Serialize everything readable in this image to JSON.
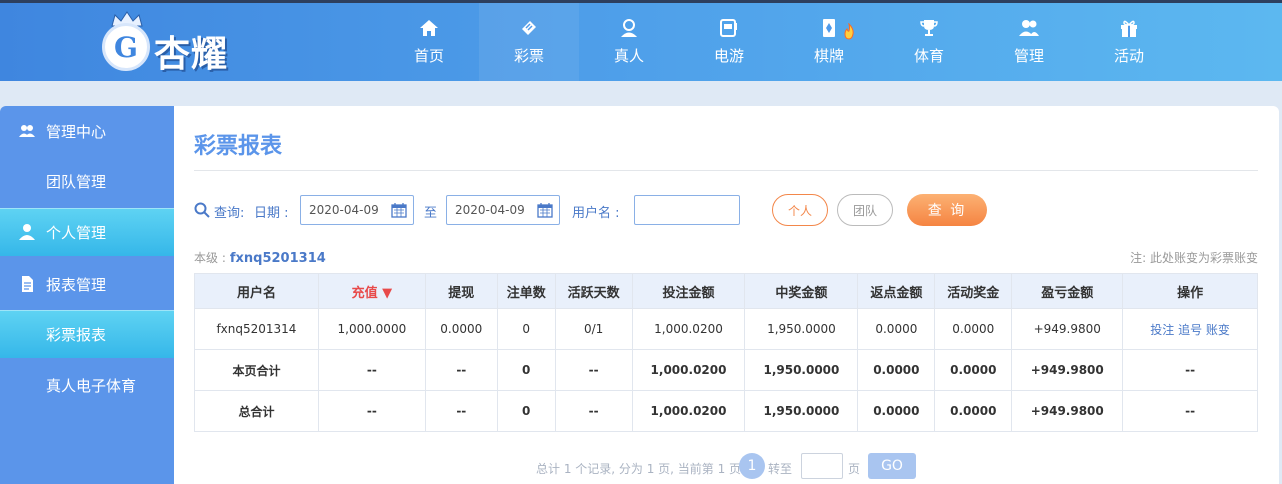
{
  "brand": {
    "name": "杏耀",
    "badge": "G"
  },
  "nav": [
    {
      "label": "首页",
      "icon": "home-icon"
    },
    {
      "label": "彩票",
      "icon": "ticket-icon"
    },
    {
      "label": "真人",
      "icon": "dealer-icon"
    },
    {
      "label": "电游",
      "icon": "slot-machine-icon"
    },
    {
      "label": "棋牌",
      "icon": "cards-icon"
    },
    {
      "label": "体育",
      "icon": "trophy-icon"
    },
    {
      "label": "管理",
      "icon": "users-icon"
    },
    {
      "label": "活动",
      "icon": "gift-icon"
    }
  ],
  "sidebar": {
    "items": [
      {
        "label": "管理中心",
        "icon": "team-icon"
      },
      {
        "label": "团队管理"
      },
      {
        "label": "个人管理",
        "icon": "user-icon"
      },
      {
        "label": "报表管理",
        "icon": "report-icon"
      },
      {
        "label": "彩票报表"
      },
      {
        "label": "真人电子体育"
      }
    ]
  },
  "page": {
    "title": "彩票报表"
  },
  "filter": {
    "query_label": "查询:",
    "date_label": "日期 :",
    "date_from": "2020-04-09",
    "to_label": "至",
    "date_to": "2020-04-09",
    "username_label": "用户名 :",
    "username_value": "",
    "personal_label": "个人",
    "team_label": "团队",
    "search_label": "查 询"
  },
  "level": {
    "label": "本级 :",
    "user": "fxnq5201314"
  },
  "note": "注: 此处账变为彩票账变",
  "table": {
    "headers": [
      "用户名",
      "充值",
      "提现",
      "注单数",
      "活跃天数",
      "投注金额",
      "中奖金额",
      "返点金额",
      "活动奖金",
      "盈亏金额",
      "操作"
    ],
    "sort_arrow": "▼",
    "row": {
      "username": "fxnq5201314",
      "recharge": "1,000.0000",
      "withdraw": "0.0000",
      "orders": "0",
      "active_days": "0/1",
      "bet": "1,000.0200",
      "win": "1,950.0000",
      "rebate": "0.0000",
      "bonus": "0.0000",
      "profit": "+949.9800",
      "actions": [
        "投注",
        "追号",
        "账变"
      ]
    },
    "page_total": {
      "label": "本页合计",
      "recharge": "--",
      "withdraw": "--",
      "orders": "0",
      "active_days": "--",
      "bet": "1,000.0200",
      "win": "1,950.0000",
      "rebate": "0.0000",
      "bonus": "0.0000",
      "profit": "+949.9800",
      "actions": "--"
    },
    "grand_total": {
      "label": "总合计",
      "recharge": "--",
      "withdraw": "--",
      "orders": "0",
      "active_days": "--",
      "bet": "1,000.0200",
      "win": "1,950.0000",
      "rebate": "0.0000",
      "bonus": "0.0000",
      "profit": "+949.9800",
      "actions": "--"
    }
  },
  "pager": {
    "info": "总计 1 个记录, 分为 1 页, 当前第 1 页",
    "current": "1",
    "goto_label": "转至",
    "page_label": "页",
    "go_label": "GO"
  },
  "colors": {
    "accent": "#5b95ea",
    "highlight": "#35b7e9",
    "orange": "#f58442",
    "profit": "#168a2c"
  }
}
